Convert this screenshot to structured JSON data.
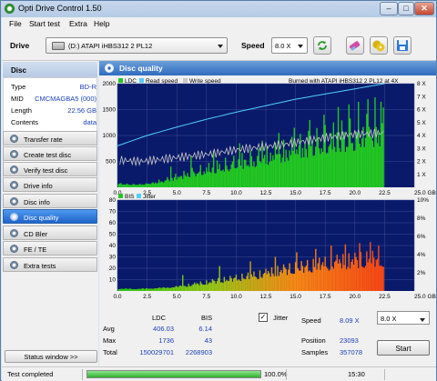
{
  "window": {
    "title": "Opti Drive Control 1.50"
  },
  "menu": [
    "File",
    "Start test",
    "Extra",
    "Help"
  ],
  "toolbar": {
    "drive_label": "Drive",
    "drive_value": "(D:)    ATAPI iHBS312    2 PL12",
    "speed_label": "Speed",
    "speed_value": "8.0 X",
    "icons": [
      "refresh-icon",
      "eraser-icon",
      "disc-copy-icon",
      "save-icon"
    ]
  },
  "disc": {
    "header": "Disc",
    "rows": [
      {
        "label": "Type",
        "value": "BD-R"
      },
      {
        "label": "MID",
        "value": "CMCMAGBA5 (000)"
      },
      {
        "label": "Length",
        "value": "22.56 GB"
      },
      {
        "label": "Contents",
        "value": "data"
      }
    ]
  },
  "nav": [
    {
      "label": "Transfer rate",
      "active": false
    },
    {
      "label": "Create test disc",
      "active": false
    },
    {
      "label": "Verify test disc",
      "active": false
    },
    {
      "label": "Drive info",
      "active": false
    },
    {
      "label": "Disc info",
      "active": false
    },
    {
      "label": "Disc quality",
      "active": true
    },
    {
      "label": "CD Bler",
      "active": false
    },
    {
      "label": "FE / TE",
      "active": false
    },
    {
      "label": "Extra tests",
      "active": false
    }
  ],
  "status_window_button": "Status window >>",
  "panel": {
    "title": "Disc quality"
  },
  "chart_data": [
    {
      "type": "area",
      "legend": [
        "LDC",
        "Read speed",
        "Write speed"
      ],
      "legend_right": "Burned with ATAPI iHBS312   2 PL12 at 4X",
      "x_ticks": [
        "0.0",
        "2.5",
        "5.0",
        "7.5",
        "10.0",
        "12.5",
        "15.0",
        "17.5",
        "20.0",
        "22.5",
        "25.0 GB"
      ],
      "y_ticks_left": [
        "2000",
        "1500",
        "1000",
        "500"
      ],
      "y_ticks_right": [
        "8 X",
        "7 X",
        "6 X",
        "5 X",
        "4 X",
        "3 X",
        "2 X",
        "1 X"
      ],
      "xlim": [
        0,
        25
      ],
      "ylim": [
        0,
        2000
      ],
      "series": [
        {
          "name": "LDC",
          "color": "#22c822",
          "x": [
            0,
            1,
            2,
            3,
            4,
            5,
            6,
            7,
            8,
            9,
            10,
            11,
            12,
            13,
            14,
            15,
            16,
            17,
            18,
            19,
            20,
            21,
            22,
            22.5
          ],
          "y": [
            80,
            60,
            60,
            90,
            130,
            200,
            260,
            320,
            360,
            420,
            460,
            520,
            560,
            620,
            680,
            740,
            800,
            860,
            920,
            960,
            1000,
            1050,
            1100,
            1150
          ]
        },
        {
          "name": "LDC peaks",
          "color": "#22c822",
          "x": [
            4.5,
            6.2,
            8.1,
            10.3,
            12.2,
            13.6,
            14.9,
            16.2,
            17.4,
            18.6,
            19.5,
            20.3,
            21.1,
            21.7,
            22.2
          ],
          "y": [
            400,
            600,
            700,
            850,
            900,
            1050,
            1150,
            1300,
            1400,
            1550,
            1600,
            1650,
            1700,
            1736,
            1650
          ]
        },
        {
          "name": "Read speed",
          "color": "#4fd0ff",
          "x": [
            0,
            2.5,
            5,
            7.5,
            10,
            12.5,
            15,
            17.5,
            20,
            22.5
          ],
          "y": [
            3.2,
            4.0,
            4.65,
            5.25,
            5.8,
            6.3,
            6.8,
            7.2,
            7.6,
            8.0
          ]
        },
        {
          "name": "Write speed",
          "color": "#c8c8c8",
          "x": [
            0,
            2,
            4,
            6,
            8,
            10,
            12,
            14,
            16,
            18,
            20,
            22.5
          ],
          "y": [
            2.1,
            2.0,
            2.2,
            2.4,
            2.6,
            2.9,
            3.1,
            3.3,
            3.6,
            3.9,
            4.1,
            4.2
          ]
        }
      ]
    },
    {
      "type": "area",
      "legend": [
        "BIS",
        "Jitter"
      ],
      "x_ticks": [
        "0.0",
        "2.5",
        "5.0",
        "7.5",
        "10.0",
        "12.5",
        "15.0",
        "17.5",
        "20.0",
        "22.5",
        "25.0 GB"
      ],
      "y_ticks_left": [
        "80",
        "70",
        "60",
        "50",
        "40",
        "30",
        "20",
        "10"
      ],
      "y_ticks_right": [
        "10%",
        "8%",
        "6%",
        "4%",
        "2%"
      ],
      "xlim": [
        0,
        25
      ],
      "ylim": [
        0,
        80
      ],
      "series": [
        {
          "name": "BIS",
          "x": [
            0,
            2,
            4,
            6,
            8,
            10,
            12,
            14,
            16,
            18,
            20,
            22.5
          ],
          "y": [
            2,
            2,
            3,
            5,
            8,
            11,
            14,
            18,
            21,
            24,
            26,
            28
          ]
        },
        {
          "name": "BIS peaks",
          "x": [
            5.5,
            8.6,
            11.2,
            13.3,
            15.1,
            16.7,
            18.0,
            19.2,
            20.4,
            21.3,
            22.0
          ],
          "y": [
            14,
            22,
            26,
            30,
            34,
            37,
            40,
            41,
            42,
            43,
            40
          ]
        }
      ]
    }
  ],
  "stats": {
    "col_ldc": "LDC",
    "col_bis": "BIS",
    "rows": [
      {
        "label": "Avg",
        "ldc": "406.03",
        "bis": "6.14"
      },
      {
        "label": "Max",
        "ldc": "1736",
        "bis": "43"
      },
      {
        "label": "Total",
        "ldc": "150029701",
        "bis": "2268903"
      }
    ],
    "jitter_label": "Jitter",
    "jitter_checked": true,
    "speed_label": "Speed",
    "speed_value": "8.09 X",
    "speed_select": "8.0 X",
    "position_label": "Position",
    "position_value": "23093",
    "samples_label": "Samples",
    "samples_value": "357078",
    "start_label": "Start"
  },
  "statusbar": {
    "text": "Test completed",
    "progress": 100,
    "progress_text": "100.0%",
    "time": "15:30"
  },
  "colors": {
    "chart_bg": "#0a1a6a",
    "ldc": "#22c822",
    "read": "#4fd0ff",
    "write": "#c8c8c8",
    "accent": "#2f6cbf"
  }
}
